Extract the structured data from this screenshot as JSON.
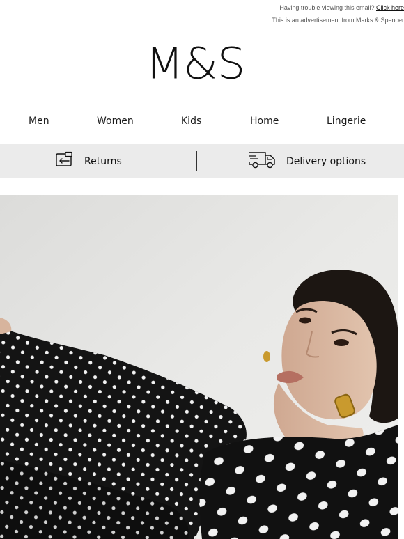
{
  "preheader": {
    "trouble_text": "Having trouble viewing this email? ",
    "click_here": "Click here",
    "advertisement": "This is an advertisement from Marks & Spencer"
  },
  "brand": {
    "logo_text": "M&S"
  },
  "nav": {
    "items": [
      {
        "label": "Men"
      },
      {
        "label": "Women"
      },
      {
        "label": "Kids"
      },
      {
        "label": "Home"
      },
      {
        "label": "Lingerie"
      }
    ]
  },
  "services": {
    "returns_label": "Returns",
    "delivery_label": "Delivery options",
    "returns_icon": "returns-icon",
    "delivery_icon": "delivery-van-icon"
  },
  "hero": {
    "image": "model-in-black-polka-dot-dress",
    "colors": {
      "background": "#e6e6e4",
      "dress": "#141414",
      "dots": "#f2f2f2",
      "skin": "#d9b9a3",
      "hair": "#1c1612"
    }
  }
}
